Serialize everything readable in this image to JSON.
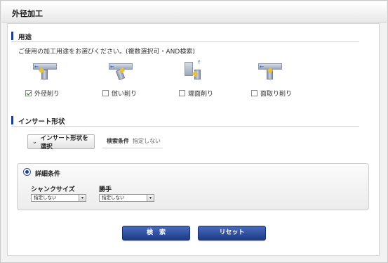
{
  "window": {
    "title": "外径加工"
  },
  "usage": {
    "heading": "用途",
    "description": "ご使用の加工用途をお選びください。(複数選択可・AND検索)",
    "options": [
      {
        "label": "外径削り",
        "checked": true,
        "icon": "outer-diameter-turning-icon"
      },
      {
        "label": "倣い削り",
        "checked": false,
        "icon": "profiling-turning-icon"
      },
      {
        "label": "端面削り",
        "checked": false,
        "icon": "facing-turning-icon"
      },
      {
        "label": "面取り削り",
        "checked": false,
        "icon": "chamfering-turning-icon"
      }
    ]
  },
  "insert": {
    "heading": "インサート形状",
    "select_button": "インサート形状を選択",
    "search_condition_label": "検索条件",
    "search_condition_value": "指定しない"
  },
  "detail": {
    "title": "詳細条件",
    "shank_label": "シャンクサイズ",
    "shank_value": "指定しない",
    "hand_label": "勝手",
    "hand_value": "指定しない"
  },
  "actions": {
    "search": "検　索",
    "reset": "リセット"
  },
  "colors": {
    "accent": "#1d3f8f",
    "button": "#2a4a9a"
  }
}
